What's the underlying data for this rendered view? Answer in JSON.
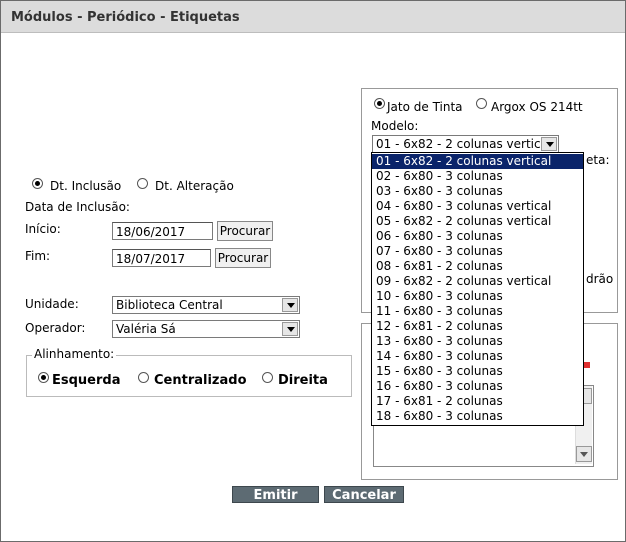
{
  "window": {
    "title": "Módulos - Periódico - Etiquetas"
  },
  "date_type": {
    "inclusao_label": "Dt. Inclusão",
    "alteracao_label": "Dt. Alteração",
    "selected": "inclusao"
  },
  "date_range": {
    "heading": "Data de Inclusão:",
    "inicio_label": "Início:",
    "inicio_value": "18/06/2017",
    "fim_label": "Fim:",
    "fim_value": "18/07/2017",
    "procurar_label": "Procurar"
  },
  "unidade": {
    "label": "Unidade:",
    "value": "Biblioteca Central"
  },
  "operador": {
    "label": "Operador:",
    "value": "Valéria Sá"
  },
  "alinhamento": {
    "legend": "Alinhamento:",
    "esquerda": "Esquerda",
    "centralizado": "Centralizado",
    "direita": "Direita",
    "selected": "esquerda"
  },
  "printer": {
    "jato_label": "Jato de Tinta",
    "argox_label": "Argox OS 214tt",
    "selected": "jato"
  },
  "modelo": {
    "label": "Modelo:",
    "value": "01 - 6x82 - 2 colunas vertica",
    "options": [
      "01 - 6x82 - 2 colunas vertical",
      "02 - 6x80 - 3 colunas",
      "03 - 6x80 - 3 colunas",
      "04 - 6x80 - 3 colunas vertical",
      "05 - 6x82 - 2 colunas vertical",
      "06 - 6x80 - 3 colunas",
      "07 - 6x80 - 3 colunas",
      "08 - 6x81 - 2 colunas",
      "09 - 6x82 - 2 colunas vertical",
      "10 - 6x80 - 3 colunas",
      "11 - 6x80 - 3 colunas",
      "12 - 6x81 - 2 colunas",
      "13 - 6x80 - 3 colunas",
      "14 - 6x80 - 3 colunas",
      "15 - 6x80 - 3 colunas",
      "16 - 6x80 - 3 colunas",
      "17 - 6x81 - 2 colunas",
      "18 - 6x80 - 3 colunas"
    ],
    "selected_index": 0
  },
  "hidden_fragments": {
    "eta": "eta:",
    "drao": "drão"
  },
  "actions": {
    "emitir": "Emitir",
    "cancelar": "Cancelar"
  }
}
